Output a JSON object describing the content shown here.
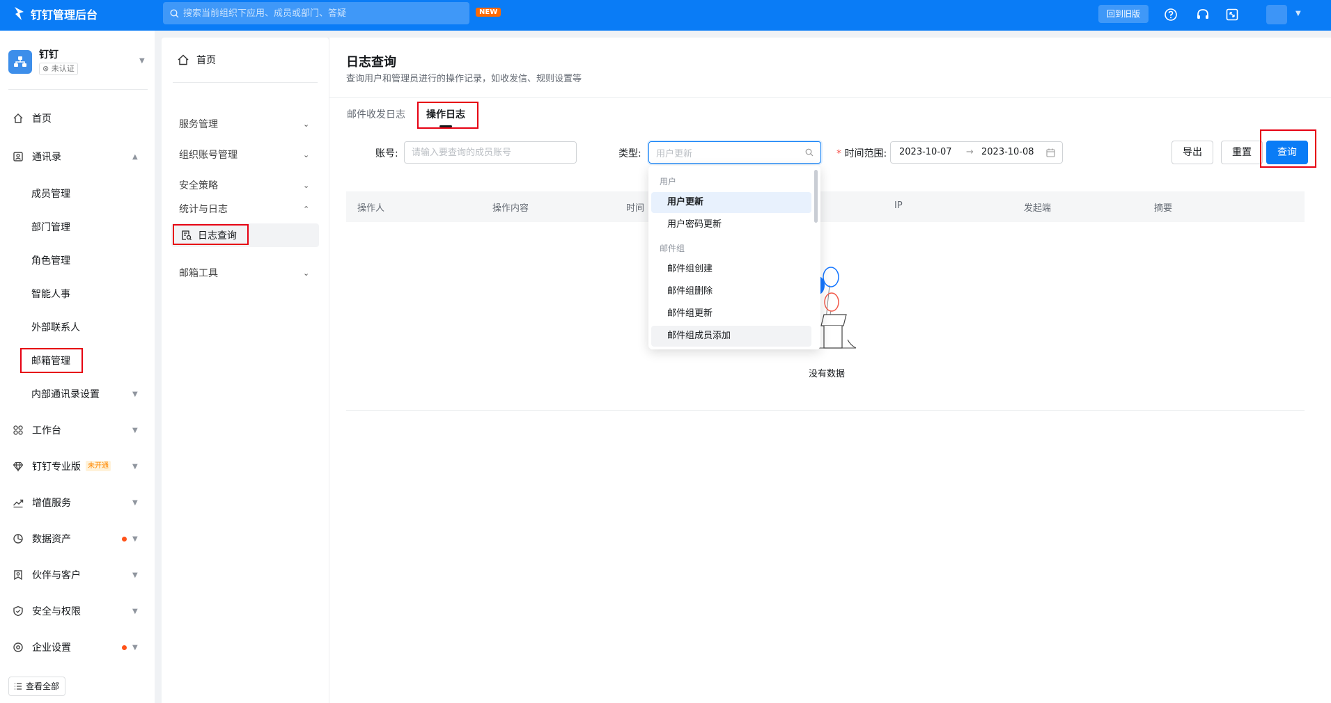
{
  "topbar": {
    "brand": "钉钉管理后台",
    "search_placeholder": "搜索当前组织下应用、成员或部门、答疑",
    "new_badge": "NEW",
    "back_old_label": "回到旧版"
  },
  "org": {
    "name": "钉钉",
    "status": "未认证"
  },
  "sidebar": {
    "items": [
      {
        "label": "首页",
        "icon": "home-icon"
      },
      {
        "label": "通讯录",
        "icon": "contacts-icon"
      },
      {
        "label": "工作台",
        "icon": "workbench-icon"
      },
      {
        "label": "钉钉专业版",
        "icon": "diamond-icon",
        "tag": "未开通"
      },
      {
        "label": "增值服务",
        "icon": "trend-icon"
      },
      {
        "label": "数据资产",
        "icon": "pie-chart-icon"
      },
      {
        "label": "伙伴与客户",
        "icon": "partner-icon"
      },
      {
        "label": "安全与权限",
        "icon": "shield-icon"
      },
      {
        "label": "企业设置",
        "icon": "settings-icon"
      }
    ],
    "contacts_sub": [
      {
        "label": "成员管理"
      },
      {
        "label": "部门管理"
      },
      {
        "label": "角色管理"
      },
      {
        "label": "智能人事"
      },
      {
        "label": "外部联系人"
      },
      {
        "label": "邮箱管理"
      },
      {
        "label": "内部通讯录设置"
      }
    ],
    "view_all": "查看全部"
  },
  "secondary_nav": {
    "home": "首页",
    "items": [
      {
        "label": "服务管理"
      },
      {
        "label": "组织账号管理"
      },
      {
        "label": "安全策略"
      },
      {
        "label": "统计与日志"
      },
      {
        "label": "邮箱工具"
      }
    ],
    "active_item": "日志查询"
  },
  "main": {
    "title": "日志查询",
    "description": "查询用户和管理员进行的操作记录，如收发信、规则设置等",
    "tabs": [
      {
        "label": "邮件收发日志"
      },
      {
        "label": "操作日志"
      }
    ],
    "filters": {
      "account_label": "账号:",
      "account_placeholder": "请输入要查询的成员账号",
      "type_label": "类型:",
      "type_placeholder": "用户更新",
      "time_required": "*",
      "time_label": "时间范围:",
      "start_date": "2023-10-07",
      "end_date": "2023-10-08",
      "range_arrow": "→"
    },
    "buttons": {
      "export": "导出",
      "reset": "重置",
      "query": "查询"
    },
    "table_headers": [
      "操作人",
      "操作内容",
      "时间",
      "IP",
      "发起端",
      "摘要"
    ],
    "empty_text": "没有数据"
  },
  "dropdown": {
    "groups": [
      {
        "name": "用户",
        "options": [
          "用户更新",
          "用户密码更新"
        ]
      },
      {
        "name": "邮件组",
        "options": [
          "邮件组创建",
          "邮件组删除",
          "邮件组更新",
          "邮件组成员添加"
        ]
      }
    ]
  },
  "colors": {
    "primary": "#0a7cf6",
    "highlight": "#e60012",
    "badge": "#ff6a00",
    "dot": "#ff5219"
  }
}
